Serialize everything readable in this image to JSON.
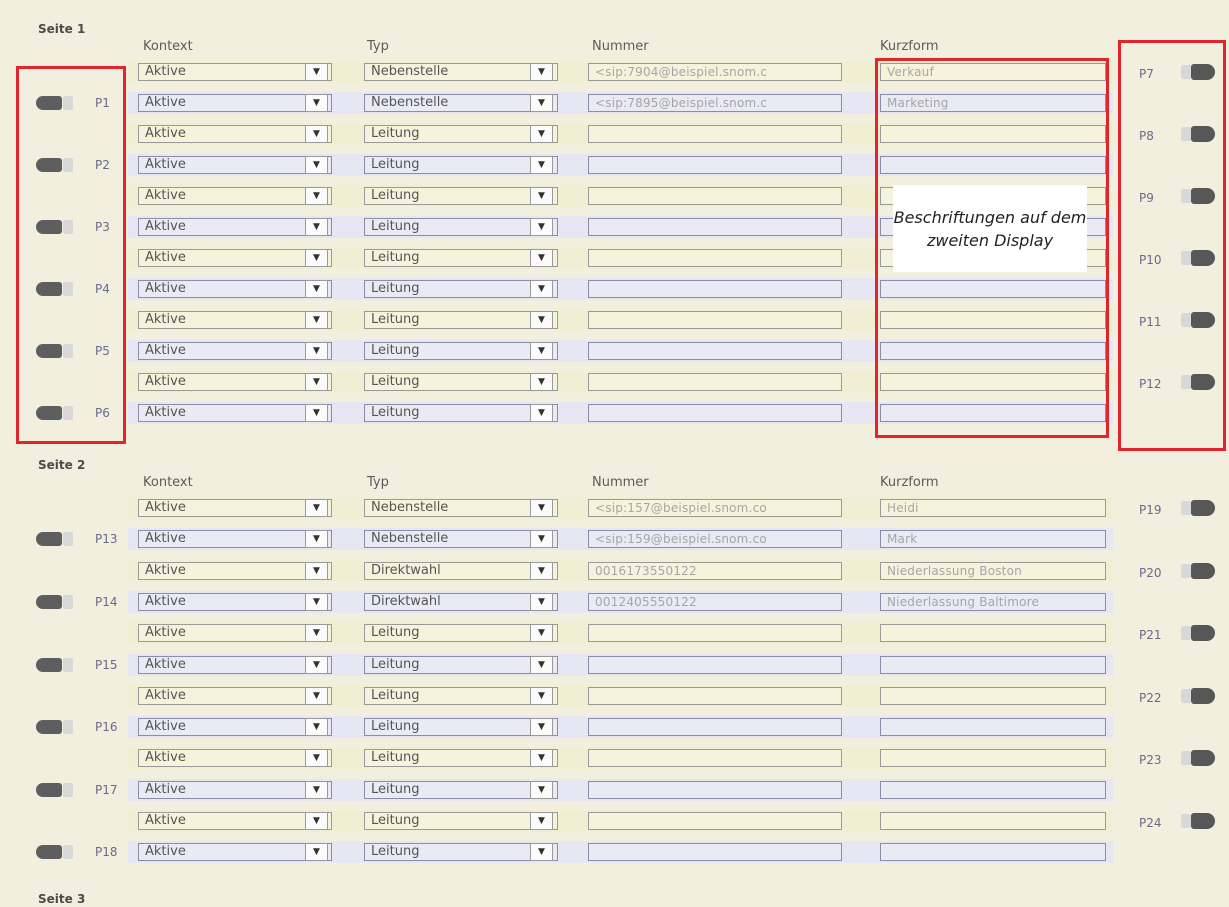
{
  "sections": [
    {
      "title": "Seite 1",
      "headers": {
        "kontext": "Kontext",
        "typ": "Typ",
        "nummer": "Nummer",
        "kurzform": "Kurzform"
      },
      "rows": [
        {
          "kontext": "Aktive",
          "typ": "Nebenstelle",
          "nummer": "<sip:7904@beispiel.snom.c",
          "kurzform": "Verkauf"
        },
        {
          "kontext": "Aktive",
          "typ": "Nebenstelle",
          "nummer": "<sip:7895@beispiel.snom.c",
          "kurzform": "Marketing"
        },
        {
          "kontext": "Aktive",
          "typ": "Leitung",
          "nummer": "",
          "kurzform": ""
        },
        {
          "kontext": "Aktive",
          "typ": "Leitung",
          "nummer": "",
          "kurzform": ""
        },
        {
          "kontext": "Aktive",
          "typ": "Leitung",
          "nummer": "",
          "kurzform": ""
        },
        {
          "kontext": "Aktive",
          "typ": "Leitung",
          "nummer": "",
          "kurzform": ""
        },
        {
          "kontext": "Aktive",
          "typ": "Leitung",
          "nummer": "",
          "kurzform": ""
        },
        {
          "kontext": "Aktive",
          "typ": "Leitung",
          "nummer": "",
          "kurzform": ""
        },
        {
          "kontext": "Aktive",
          "typ": "Leitung",
          "nummer": "",
          "kurzform": ""
        },
        {
          "kontext": "Aktive",
          "typ": "Leitung",
          "nummer": "",
          "kurzform": ""
        },
        {
          "kontext": "Aktive",
          "typ": "Leitung",
          "nummer": "",
          "kurzform": ""
        },
        {
          "kontext": "Aktive",
          "typ": "Leitung",
          "nummer": "",
          "kurzform": ""
        }
      ],
      "left_keys": [
        "P1",
        "P2",
        "P3",
        "P4",
        "P5",
        "P6"
      ],
      "right_keys": [
        "P7",
        "P8",
        "P9",
        "P10",
        "P11",
        "P12"
      ]
    },
    {
      "title": "Seite 2",
      "headers": {
        "kontext": "Kontext",
        "typ": "Typ",
        "nummer": "Nummer",
        "kurzform": "Kurzform"
      },
      "rows": [
        {
          "kontext": "Aktive",
          "typ": "Nebenstelle",
          "nummer": "<sip:157@beispiel.snom.co",
          "kurzform": "Heidi"
        },
        {
          "kontext": "Aktive",
          "typ": "Nebenstelle",
          "nummer": "<sip:159@beispiel.snom.co",
          "kurzform": "Mark"
        },
        {
          "kontext": "Aktive",
          "typ": "Direktwahl",
          "nummer": "0016173550122",
          "kurzform": "Niederlassung Boston"
        },
        {
          "kontext": "Aktive",
          "typ": "Direktwahl",
          "nummer": "0012405550122",
          "kurzform": "Niederlassung Baltimore"
        },
        {
          "kontext": "Aktive",
          "typ": "Leitung",
          "nummer": "",
          "kurzform": ""
        },
        {
          "kontext": "Aktive",
          "typ": "Leitung",
          "nummer": "",
          "kurzform": ""
        },
        {
          "kontext": "Aktive",
          "typ": "Leitung",
          "nummer": "",
          "kurzform": ""
        },
        {
          "kontext": "Aktive",
          "typ": "Leitung",
          "nummer": "",
          "kurzform": ""
        },
        {
          "kontext": "Aktive",
          "typ": "Leitung",
          "nummer": "",
          "kurzform": ""
        },
        {
          "kontext": "Aktive",
          "typ": "Leitung",
          "nummer": "",
          "kurzform": ""
        },
        {
          "kontext": "Aktive",
          "typ": "Leitung",
          "nummer": "",
          "kurzform": ""
        },
        {
          "kontext": "Aktive",
          "typ": "Leitung",
          "nummer": "",
          "kurzform": ""
        }
      ],
      "left_keys": [
        "P13",
        "P14",
        "P15",
        "P16",
        "P17",
        "P18"
      ],
      "right_keys": [
        "P19",
        "P20",
        "P21",
        "P22",
        "P23",
        "P24"
      ]
    },
    {
      "title": "Seite 3"
    }
  ],
  "annotation": {
    "text": "Beschriftungen auf dem zweiten Display"
  },
  "icons": {
    "dropdown": "chevron-down-icon",
    "key": "function-key-icon"
  },
  "colors": {
    "highlight": "#e0262c",
    "background": "#f3efdf",
    "row_odd": "#e6e7f2",
    "row_even": "#f1efd3"
  }
}
